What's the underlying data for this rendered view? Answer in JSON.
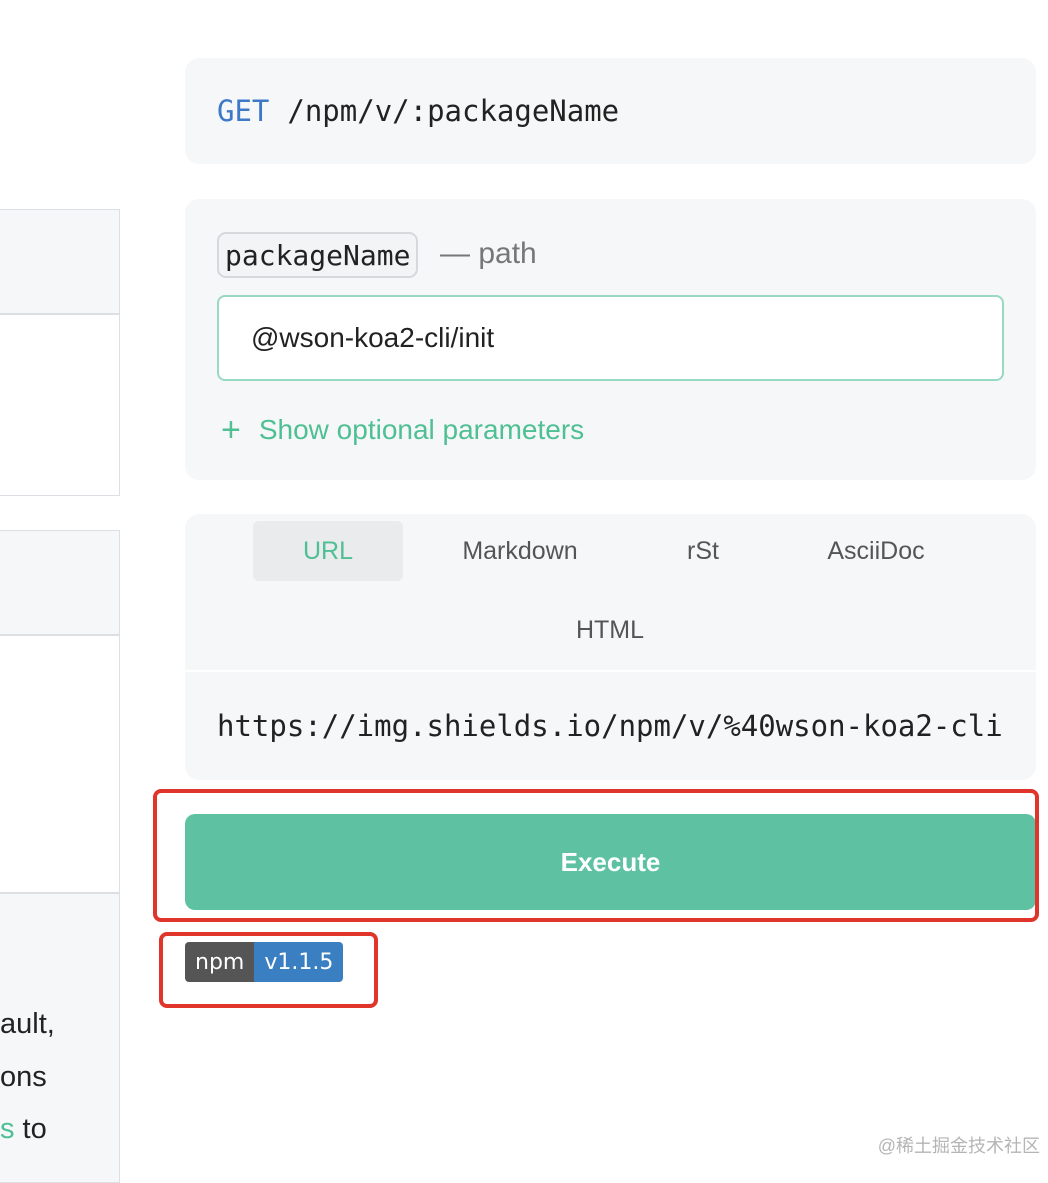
{
  "endpoint": {
    "method": "GET",
    "path": "/npm/v/:packageName"
  },
  "params": {
    "name": "packageName",
    "kind": "— path",
    "value": "@wson-koa2-cli/init",
    "optional_label": "Show optional parameters"
  },
  "formats": {
    "tabs": [
      {
        "label": "URL",
        "active": true
      },
      {
        "label": "Markdown"
      },
      {
        "label": "rSt"
      },
      {
        "label": "AsciiDoc"
      },
      {
        "label": "HTML"
      }
    ]
  },
  "url_output": "https://img.shields.io/npm/v/%40wson-koa2-cli",
  "execute_label": "Execute",
  "badge": {
    "label": "npm",
    "value": "v1.1.5"
  },
  "left_fragments": {
    "line1": "ault,",
    "line2": "ons",
    "line3_accent": "s",
    "line3_rest": " to"
  },
  "watermark": "@稀土掘金技术社区",
  "colors": {
    "accent": "#4fbf94",
    "method": "#3d79c7",
    "execute": "#5ec2a2",
    "highlight": "#e0352b"
  }
}
